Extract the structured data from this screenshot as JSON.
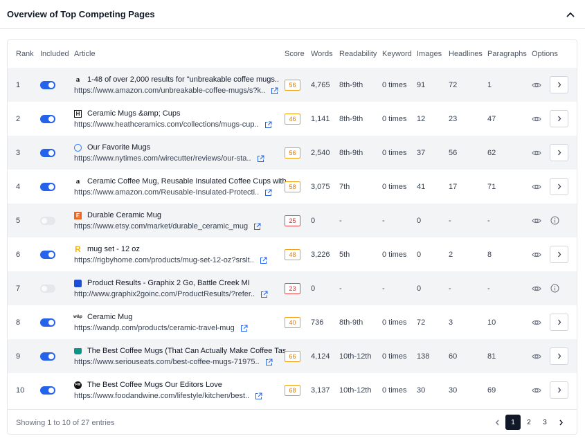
{
  "header": {
    "title": "Overview of Top Competing Pages"
  },
  "columns": {
    "rank": "Rank",
    "included": "Included",
    "article": "Article",
    "score": "Score",
    "words": "Words",
    "readability": "Readability",
    "keyword": "Keyword",
    "images": "Images",
    "headlines": "Headlines",
    "paragraphs": "Paragraphs",
    "options": "Options"
  },
  "rows": [
    {
      "rank": "1",
      "included": true,
      "favicon": "amazon-icon",
      "title": "1-48 of over 2,000 results for \"unbreakable coffee mugs..",
      "url": "https://www.amazon.com/unbreakable-coffee-mugs/s?k..",
      "score": "56",
      "score_level": "medium",
      "words": "4,765",
      "readability": "8th-9th",
      "keyword": "0 times",
      "images": "91",
      "headlines": "72",
      "paragraphs": "1"
    },
    {
      "rank": "2",
      "included": true,
      "favicon": "heath-icon",
      "title": "Ceramic Mugs &amp; Cups",
      "url": "https://www.heathceramics.com/collections/mugs-cup..",
      "score": "46",
      "score_level": "medium",
      "words": "1,141",
      "readability": "8th-9th",
      "keyword": "0 times",
      "images": "12",
      "headlines": "23",
      "paragraphs": "47"
    },
    {
      "rank": "3",
      "included": true,
      "favicon": "nytimes-icon",
      "title": "Our Favorite Mugs",
      "url": "https://www.nytimes.com/wirecutter/reviews/our-sta..",
      "score": "56",
      "score_level": "medium",
      "words": "2,540",
      "readability": "8th-9th",
      "keyword": "0 times",
      "images": "37",
      "headlines": "56",
      "paragraphs": "62"
    },
    {
      "rank": "4",
      "included": true,
      "favicon": "amazon-icon",
      "title": "Ceramic Coffee Mug, Reusable Insulated Coffee Cups with..",
      "url": "https://www.amazon.com/Reusable-Insulated-Protecti..",
      "score": "58",
      "score_level": "medium",
      "words": "3,075",
      "readability": "7th",
      "keyword": "0 times",
      "images": "41",
      "headlines": "17",
      "paragraphs": "71"
    },
    {
      "rank": "5",
      "included": false,
      "favicon": "etsy-icon",
      "title": "Durable Ceramic Mug",
      "url": "https://www.etsy.com/market/durable_ceramic_mug",
      "score": "25",
      "score_level": "low",
      "words": "0",
      "readability": "-",
      "keyword": "-",
      "images": "0",
      "headlines": "-",
      "paragraphs": "-"
    },
    {
      "rank": "6",
      "included": true,
      "favicon": "rigby-icon",
      "title": "mug set - 12 oz",
      "url": "https://rigbyhome.com/products/mug-set-12-oz?srslt..",
      "score": "48",
      "score_level": "medium",
      "words": "3,226",
      "readability": "5th",
      "keyword": "0 times",
      "images": "0",
      "headlines": "2",
      "paragraphs": "8"
    },
    {
      "rank": "7",
      "included": false,
      "favicon": "graphix-icon",
      "title": "Product Results - Graphix 2 Go, Battle Creek MI",
      "url": "http://www.graphix2goinc.com/ProductResults/?refer..",
      "score": "23",
      "score_level": "low",
      "words": "0",
      "readability": "-",
      "keyword": "-",
      "images": "0",
      "headlines": "-",
      "paragraphs": "-"
    },
    {
      "rank": "8",
      "included": true,
      "favicon": "wandp-icon",
      "title": "Ceramic Mug",
      "url": "https://wandp.com/products/ceramic-travel-mug",
      "score": "40",
      "score_level": "medium",
      "words": "736",
      "readability": "8th-9th",
      "keyword": "0 times",
      "images": "72",
      "headlines": "3",
      "paragraphs": "10"
    },
    {
      "rank": "9",
      "included": true,
      "favicon": "seriouseats-icon",
      "title": "The Best Coffee Mugs (That Can Actually Make Coffee Tas..",
      "url": "https://www.seriouseats.com/best-coffee-mugs-71975..",
      "score": "66",
      "score_level": "medium",
      "words": "4,124",
      "readability": "10th-12th",
      "keyword": "0 times",
      "images": "138",
      "headlines": "60",
      "paragraphs": "81"
    },
    {
      "rank": "10",
      "included": true,
      "favicon": "foodandwine-icon",
      "title": "The Best Coffee Mugs Our Editors Love",
      "url": "https://www.foodandwine.com/lifestyle/kitchen/best..",
      "score": "68",
      "score_level": "medium",
      "words": "3,137",
      "readability": "10th-12th",
      "keyword": "0 times",
      "images": "30",
      "headlines": "30",
      "paragraphs": "69"
    }
  ],
  "footer": {
    "entries_text": "Showing 1 to 10 of 27 entries",
    "pages": [
      "1",
      "2",
      "3"
    ],
    "current_page": "1"
  },
  "colors": {
    "accent": "#2563eb",
    "score_medium": "#d97706",
    "score_low": "#dc2626",
    "row_alt": "#f3f4f6"
  }
}
